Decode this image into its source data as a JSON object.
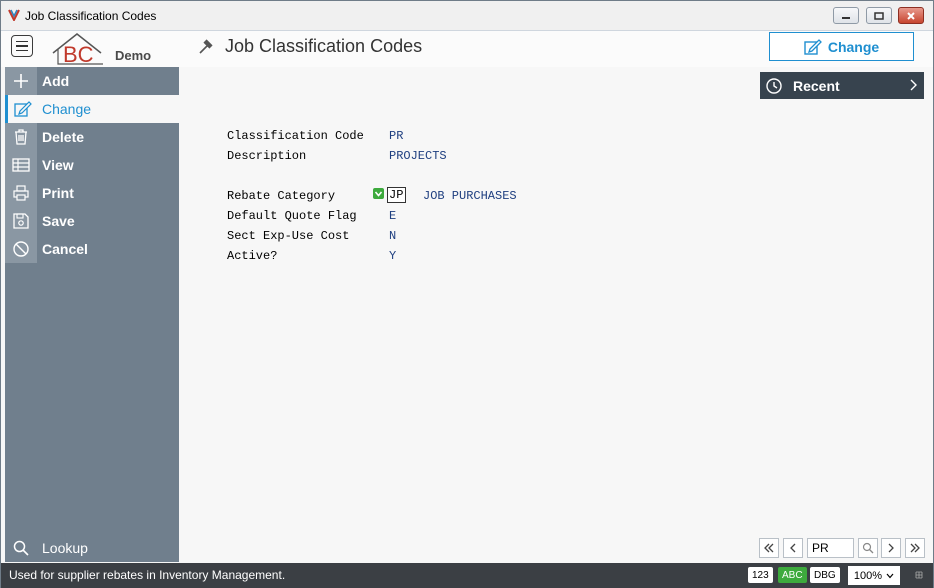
{
  "window": {
    "title": "Job Classification Codes"
  },
  "header": {
    "logo_text": "BC",
    "logo_tag": "Demo",
    "page_title": "Job Classification Codes",
    "change_button": "Change"
  },
  "sidebar": {
    "items": [
      {
        "label": "Add",
        "icon": "plus-icon"
      },
      {
        "label": "Change",
        "icon": "edit-icon"
      },
      {
        "label": "Delete",
        "icon": "trash-icon"
      },
      {
        "label": "View",
        "icon": "table-icon"
      },
      {
        "label": "Print",
        "icon": "printer-icon"
      },
      {
        "label": "Save",
        "icon": "floppy-icon"
      },
      {
        "label": "Cancel",
        "icon": "cancel-icon"
      }
    ],
    "lookup": "Lookup"
  },
  "recent": {
    "label": "Recent"
  },
  "form": {
    "classification_code_label": "Classification Code",
    "classification_code_value": "PR",
    "description_label": "Description",
    "description_value": "PROJECTS",
    "rebate_category_label": "Rebate Category",
    "rebate_category_value": "JP",
    "rebate_category_desc": "JOB PURCHASES",
    "default_quote_flag_label": "Default Quote Flag",
    "default_quote_flag_value": "E",
    "sect_exp_use_cost_label": "Sect Exp-Use Cost",
    "sect_exp_use_cost_value": "N",
    "active_label": "Active?",
    "active_value": "Y"
  },
  "pager": {
    "current": "PR"
  },
  "statusbar": {
    "message": "Used for supplier rebates in Inventory Management.",
    "badge_123": "123",
    "badge_abc": "ABC",
    "badge_dbg": "DBG",
    "zoom": "100%"
  },
  "colors": {
    "accent": "#1f8fd0",
    "sidebar": "#707f8d",
    "statusbar": "#3b3f44",
    "abc_badge": "#3daa3d"
  }
}
